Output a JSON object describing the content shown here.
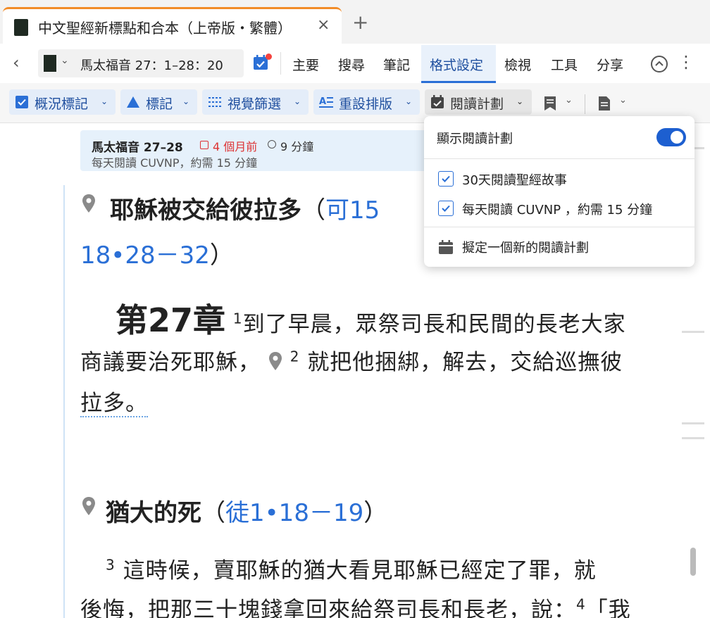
{
  "tab": {
    "title": "中文聖經新標點和合本（上帝版・繁體）",
    "close": "×",
    "new_tab": "+"
  },
  "nav": {
    "back": "‹",
    "reference": "馬太福音 27：1–28：20"
  },
  "menu": {
    "items": [
      "主要",
      "搜尋",
      "筆記",
      "格式設定",
      "檢視",
      "工具",
      "分享"
    ],
    "active_index": 3
  },
  "format_toolbar": {
    "buttons": [
      "概況標記",
      "標記",
      "視覺篩選",
      "重設排版",
      "閱讀計劃"
    ]
  },
  "reading_card": {
    "title": "馬太福音 27–28",
    "age": "4 個月前",
    "duration": "9 分鐘",
    "subtitle": "每天閱讀 CUVNP，約需 15 分鐘"
  },
  "dropdown": {
    "toggle_label": "顯示閱讀計劃",
    "toggle_on": true,
    "plans": [
      "30天閱讀聖經故事",
      "每天閱讀 CUVNP ，約需 15 分鐘"
    ],
    "new_plan": "擬定一個新的閱讀計劃"
  },
  "passage": {
    "heading1": "耶穌被交給彼拉多",
    "heading1_xref_a": "可15",
    "heading1_xref_b": "18•28－32",
    "open_paren": "（",
    "close_paren": "）",
    "chapter": "第27章",
    "v1_num": "1",
    "line1": "到了早晨，眾祭司長和民間的長老大家",
    "line2a": "商議要治死耶穌，",
    "v2_num": "2",
    "line2b": "就把他捆綁，解去，交給巡撫彼",
    "line3": "拉多。",
    "heading2": "猶大的死",
    "heading2_xref": "徒1•18－19",
    "v3_num": "3",
    "line4": "這時候，賣耶穌的猶大看見耶穌已經定了罪，就",
    "line5a": "後悔，把那三十塊錢拿回來給祭司長和長老，說：",
    "v4_num": "4",
    "line5b": "「我"
  },
  "colors": {
    "accent": "#2a6fd6",
    "tab_indicator": "#f28c28",
    "toggle": "#1d5fd0",
    "alert": "#f4433f"
  },
  "icons": [
    "book-icon",
    "close-icon",
    "plus-icon",
    "back-icon",
    "calendar-icon",
    "chevron-up-icon",
    "more-icon",
    "pin-icon",
    "check-icon"
  ]
}
